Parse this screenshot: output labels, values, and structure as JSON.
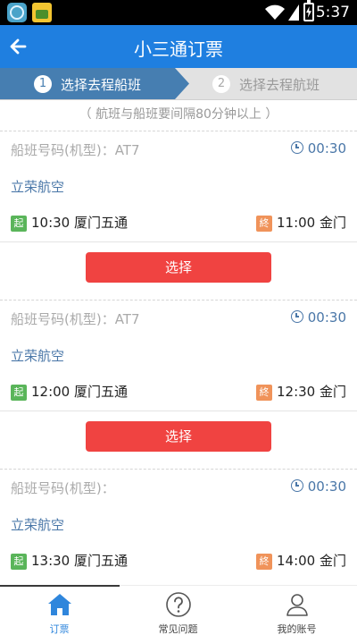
{
  "status_bar": {
    "time": "5:37"
  },
  "app_bar": {
    "title": "小三通订票"
  },
  "steps": [
    {
      "number": "1",
      "label": "选择去程船班"
    },
    {
      "number": "2",
      "label": "选择去程航班"
    }
  ],
  "note": "（ 航班与船班要间隔80分钟以上 ）",
  "cards": [
    {
      "code": "船班号码(机型)：AT7",
      "duration": "00:30",
      "airline": "立荣航空",
      "start_badge": "起",
      "departure": "10:30 厦门五通",
      "end_badge": "終",
      "arrival": "11:00 金门",
      "button": "选择"
    },
    {
      "code": "船班号码(机型)：AT7",
      "duration": "00:30",
      "airline": "立荣航空",
      "start_badge": "起",
      "departure": "12:00 厦门五通",
      "end_badge": "終",
      "arrival": "12:30 金门",
      "button": "选择"
    },
    {
      "code": "船班号码(机型)：",
      "duration": "00:30",
      "airline": "立荣航空",
      "start_badge": "起",
      "departure": "13:30 厦门五通",
      "end_badge": "終",
      "arrival": "14:00 金门"
    }
  ],
  "tabs": [
    {
      "label": "订票"
    },
    {
      "label": "常见问题"
    },
    {
      "label": "我的账号"
    }
  ],
  "colors": {
    "primary": "#1f7fe0",
    "step_active": "#467eb1",
    "select_button": "#f04341",
    "link_blue": "#4a77a8"
  }
}
